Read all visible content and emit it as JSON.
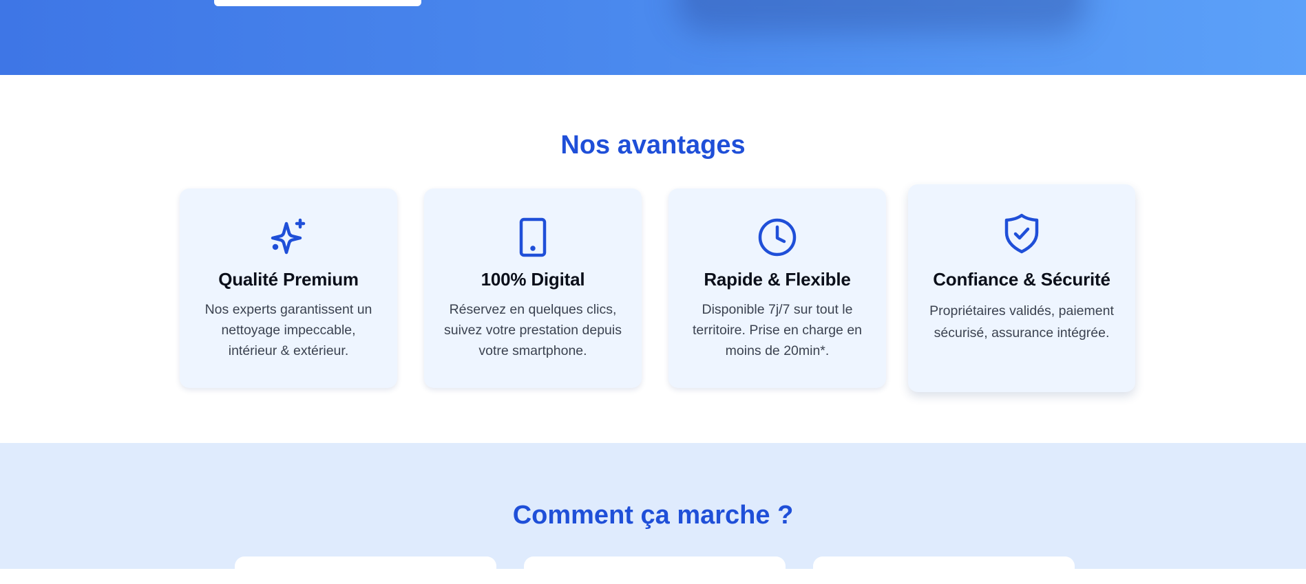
{
  "advantages": {
    "title": "Nos avantages",
    "cards": [
      {
        "icon": "sparkles-icon",
        "title": "Qualité Premium",
        "text": "Nos experts garantissent un nettoyage impeccable, intérieur & extérieur."
      },
      {
        "icon": "smartphone-icon",
        "title": "100% Digital",
        "text": "Réservez en quelques clics, suivez votre prestation depuis votre smartphone."
      },
      {
        "icon": "clock-icon",
        "title": "Rapide & Flexible",
        "text": "Disponible 7j/7 sur tout le territoire. Prise en charge en moins de 20min*."
      },
      {
        "icon": "shield-check-icon",
        "title": "Confiance & Sécurité",
        "text": "Propriétaires validés, paiement sécurisé, assurance intégrée."
      }
    ]
  },
  "how_it_works": {
    "title": "Comment ça marche ?"
  },
  "colors": {
    "accent": "#1f4fd8",
    "card_bg": "#eef5ff",
    "section_bg": "#dfebfd",
    "hero_start": "#3e76e6",
    "hero_end": "#5ca1f9"
  }
}
